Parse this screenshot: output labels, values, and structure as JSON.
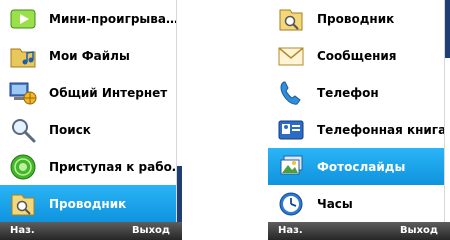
{
  "left_screen": {
    "items": [
      {
        "label": "Мини-проигрыва…",
        "icon": "play-icon",
        "selected": false
      },
      {
        "label": "Мои Файлы",
        "icon": "music-folder-icon",
        "selected": false
      },
      {
        "label": "Общий Интернет",
        "icon": "computer-sharing-icon",
        "selected": false
      },
      {
        "label": "Поиск",
        "icon": "magnifier-icon",
        "selected": false
      },
      {
        "label": "Приступая к рабо…",
        "icon": "green-globe-icon",
        "selected": false
      },
      {
        "label": "Проводник",
        "icon": "explorer-folder-icon",
        "selected": true
      }
    ],
    "softkeys": {
      "left": "Наз.",
      "right": "Выход"
    }
  },
  "right_screen": {
    "items": [
      {
        "label": "Проводник",
        "icon": "explorer-folder-icon",
        "selected": false
      },
      {
        "label": "Сообщения",
        "icon": "envelope-icon",
        "selected": false
      },
      {
        "label": "Телефон",
        "icon": "phone-handset-icon",
        "selected": false
      },
      {
        "label": "Телефонная книга",
        "icon": "contact-card-icon",
        "selected": false
      },
      {
        "label": "Фотослайды",
        "icon": "photos-icon",
        "selected": true
      },
      {
        "label": "Часы",
        "icon": "clock-icon",
        "selected": false
      }
    ],
    "softkeys": {
      "left": "Наз.",
      "right": "Выход"
    }
  },
  "colors": {
    "selection": "#1ba3ea",
    "softkey_bar": "#3a3a3a",
    "scroll_thumb": "#1f3e74"
  }
}
